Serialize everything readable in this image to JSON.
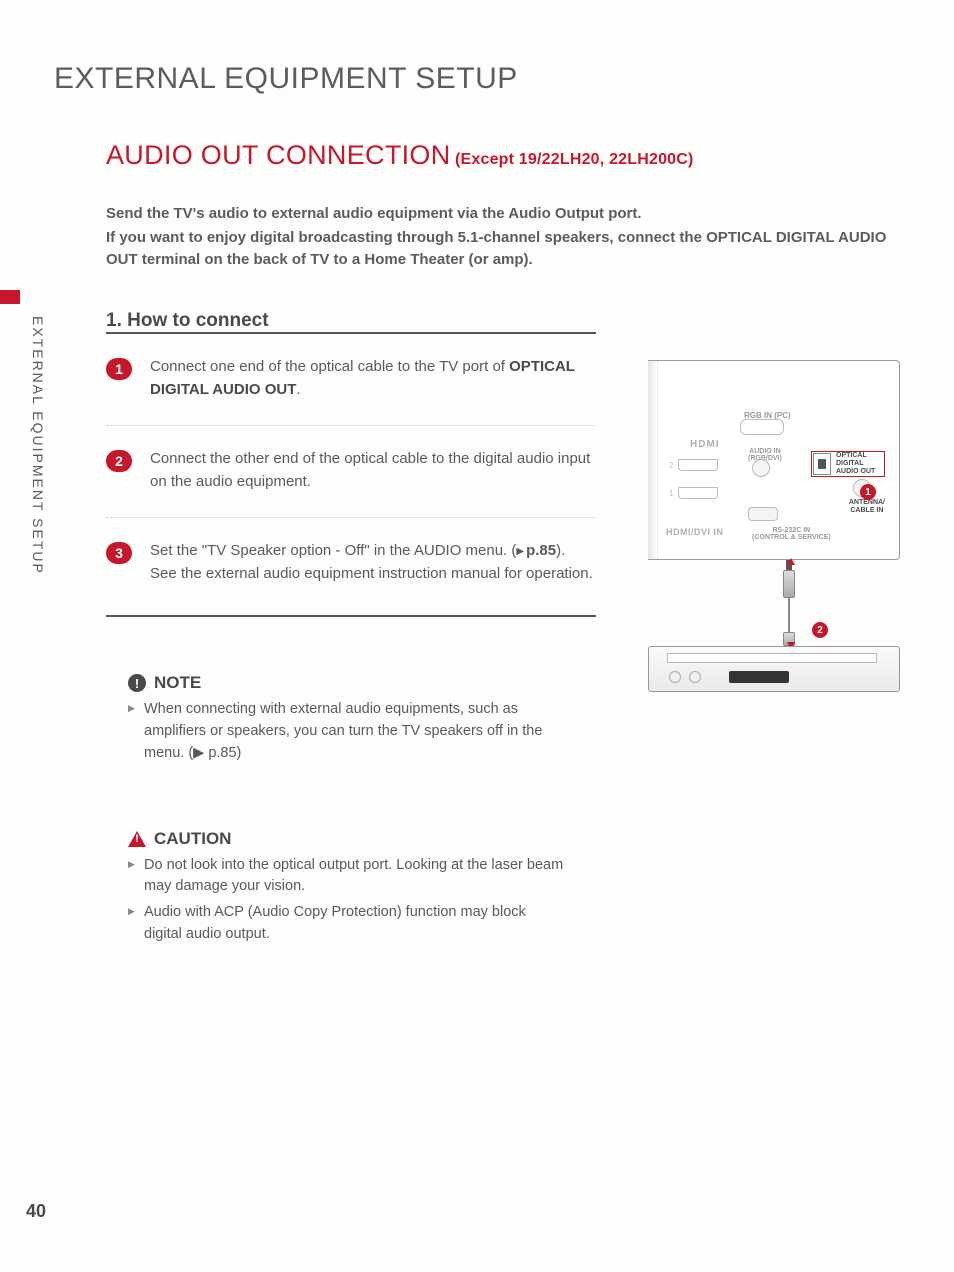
{
  "sectionTitle": "EXTERNAL EQUIPMENT SETUP",
  "subTitle": "AUDIO OUT CONNECTION",
  "subTitleNote": "(Except 19/22LH20, 22LH200C)",
  "intro": {
    "line1": "Send the TV's audio to external audio equipment via the Audio Output port.",
    "line2": "If you want to enjoy digital broadcasting through 5.1-channel speakers, connect the OPTICAL DIGITAL AUDIO OUT terminal on the back of TV to a Home Theater (or amp)."
  },
  "heading2": "1. How to connect",
  "steps": [
    {
      "num": "1",
      "pre": "Connect one end of the optical cable to the TV port of ",
      "bold": "OPTICAL DIGITAL AUDIO OUT",
      "post": "."
    },
    {
      "num": "2",
      "pre": "Connect the other end of the optical cable to the digital audio input on the audio equipment.",
      "bold": "",
      "post": ""
    },
    {
      "num": "3",
      "pre": "Set the \"TV Speaker option - Off\" in the AUDIO menu. (",
      "ref": "p.85",
      "post": "). See the external audio equipment instruction manual for operation."
    }
  ],
  "note": {
    "title": "NOTE",
    "items": [
      "When connecting with external audio equipments, such as amplifiers or speakers, you can turn the TV speakers off in the menu.  (▶ p.85)"
    ]
  },
  "caution": {
    "title": "CAUTION",
    "items": [
      "Do not look into the optical output port. Looking at the laser beam may damage your vision.",
      "Audio with ACP (Audio Copy Protection) function may block digital audio output."
    ]
  },
  "diagram": {
    "rgbIn": "RGB IN (PC)",
    "hdmi": "HDMI",
    "hdmiDviIn": "HDMI/DVI IN",
    "audioIn": "AUDIO IN\n(RGB/DVI)",
    "rs232": "RS-232C IN\n(CONTROL & SERVICE)",
    "optical": "OPTICAL DIGITAL\nAUDIO OUT",
    "antenna": "ANTENNA/\nCABLE IN",
    "port1": "1",
    "port2": "2",
    "badge1": "1",
    "badge2": "2"
  },
  "sideLabel": "EXTERNAL EQUIPMENT SETUP",
  "pageNumber": "40"
}
